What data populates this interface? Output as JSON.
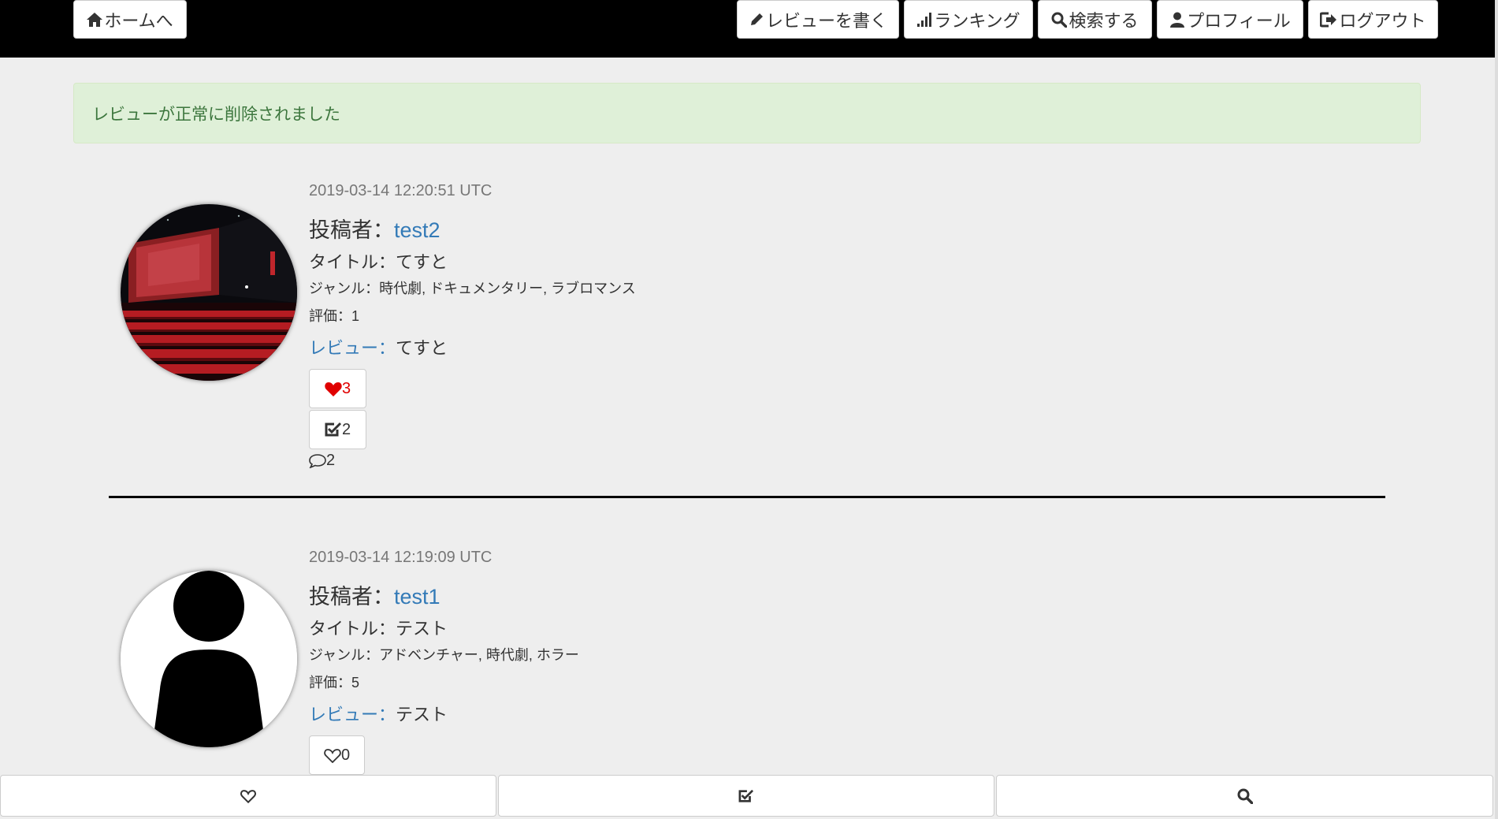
{
  "navbar": {
    "home_label": "ホームへ",
    "write_label": "レビューを書く",
    "ranking_label": "ランキング",
    "search_label": "検索する",
    "profile_label": "プロフィール",
    "logout_label": "ログアウト"
  },
  "alert": {
    "message": "レビューが正常に削除されました"
  },
  "reviews": [
    {
      "date": "2019-03-14 12:20:51 UTC",
      "author_prefix": "投稿者：",
      "author": "test2",
      "title": "タイトル：てすと",
      "genre": "ジャンル：時代劇, ドキュメンタリー, ラブロマンス",
      "rating": "評価：1",
      "review_prefix": "レビュー：",
      "review": "てすと",
      "likes": "3",
      "checks": "2",
      "comments": "2"
    },
    {
      "date": "2019-03-14 12:19:09 UTC",
      "author_prefix": "投稿者：",
      "author": "test1",
      "title": "タイトル：テスト",
      "genre": "ジャンル：アドベンチャー, 時代劇, ホラー",
      "rating": "評価：5",
      "review_prefix": "レビュー：",
      "review": "テスト",
      "likes": "0"
    }
  ],
  "colors": {
    "navbar_bg": "#000000",
    "alert_bg": "#dff0d8",
    "alert_text": "#3c763d",
    "link": "#337ab7",
    "liked_heart": "#e00000"
  }
}
